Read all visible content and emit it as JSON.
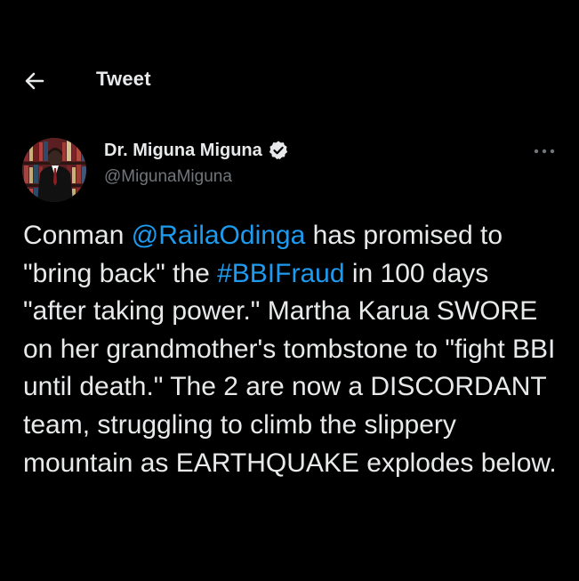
{
  "header": {
    "title": "Tweet",
    "back_icon": "arrow-left-icon"
  },
  "author": {
    "display_name": "Dr. Miguna Miguna",
    "handle": "@MigunaMiguna",
    "verified_icon": "verified-badge-icon",
    "more_icon": "more-horizontal-icon",
    "avatar": "avatar"
  },
  "tweet": {
    "t1": "Conman ",
    "mention": "@RailaOdinga",
    "t2": " has promised to \"bring back\" the ",
    "hashtag": "#BBIFraud",
    "t3": " in 100 days \"after taking power.\" Martha Karua SWORE on her grandmother's tombstone to \"fight BBI until death.\" The 2 are now a DISCORDANT team, struggling to climb the slippery mountain as EARTHQUAKE explodes below."
  },
  "colors": {
    "background": "#000000",
    "text": "#e7e9ea",
    "secondary": "#71767b",
    "link": "#1d9bf0"
  }
}
